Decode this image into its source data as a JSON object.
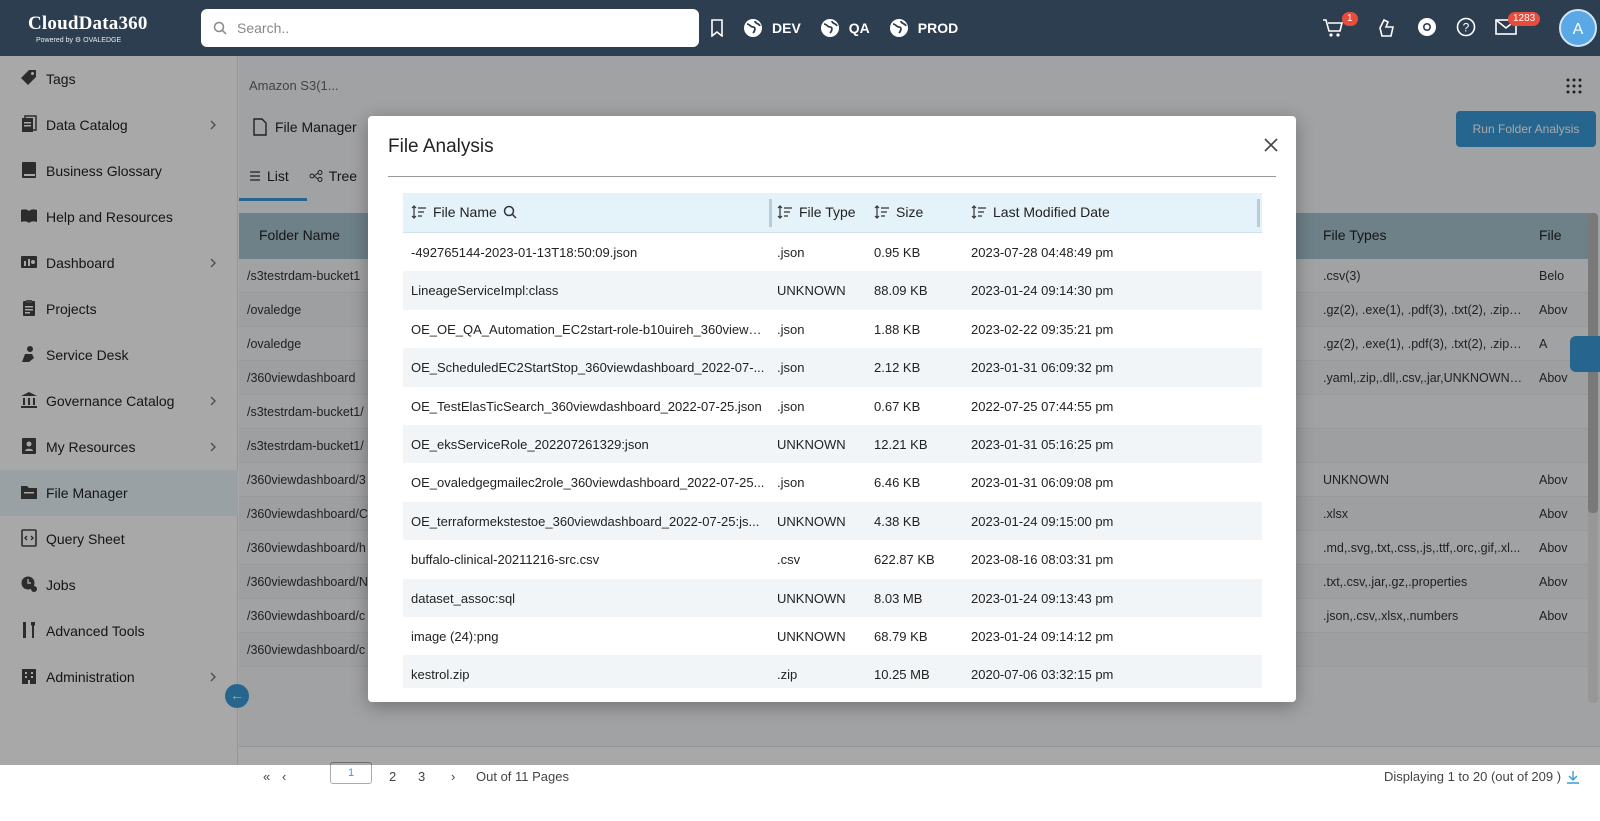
{
  "app": {
    "name": "CloudData360",
    "powered_by": "Powered by ⚙ OVALEDGE"
  },
  "search": {
    "placeholder": "Search.."
  },
  "environments": [
    "DEV",
    "QA",
    "PROD"
  ],
  "topbar": {
    "cart_count": "1",
    "mail_count": "1283",
    "avatar": "A"
  },
  "sidebar": {
    "items": [
      {
        "label": "Tags",
        "icon": "tag-icon",
        "chevron": false
      },
      {
        "label": "Data Catalog",
        "icon": "catalog-icon",
        "chevron": true
      },
      {
        "label": "Business Glossary",
        "icon": "book-icon",
        "chevron": false
      },
      {
        "label": "Help and Resources",
        "icon": "open-book-icon",
        "chevron": false
      },
      {
        "label": "Dashboard",
        "icon": "dashboard-icon",
        "chevron": true
      },
      {
        "label": "Projects",
        "icon": "clipboard-icon",
        "chevron": false
      },
      {
        "label": "Service Desk",
        "icon": "service-desk-icon",
        "chevron": false
      },
      {
        "label": "Governance Catalog",
        "icon": "bank-icon",
        "chevron": true
      },
      {
        "label": "My Resources",
        "icon": "user-card-icon",
        "chevron": true
      },
      {
        "label": "File Manager",
        "icon": "folder-icon",
        "chevron": false,
        "active": true
      },
      {
        "label": "Query Sheet",
        "icon": "code-file-icon",
        "chevron": false
      },
      {
        "label": "Jobs",
        "icon": "clock-icon",
        "chevron": false
      },
      {
        "label": "Advanced Tools",
        "icon": "tools-icon",
        "chevron": false
      },
      {
        "label": "Administration",
        "icon": "building-icon",
        "chevron": true
      }
    ]
  },
  "page": {
    "breadcrumb": "Amazon S3(1...",
    "title": "File Manager",
    "run_button": "Run Folder Analysis",
    "tabs": [
      "List",
      "Tree"
    ]
  },
  "bg_table": {
    "headers": [
      "Folder Name",
      "File Types",
      "File"
    ],
    "rows": [
      [
        "/s3testrdam-bucket1",
        ".csv(3)",
        "Belo"
      ],
      [
        "/ovaledge",
        ".gz(2), .exe(1), .pdf(3), .txt(2), .zip(...",
        "Abov"
      ],
      [
        "/ovaledge",
        ".gz(2), .exe(1), .pdf(3), .txt(2), .zip(...",
        "A"
      ],
      [
        "/360viewdashboard",
        ".yaml,.zip,.dll,.csv,.jar,UNKNOWN,...",
        "Abov"
      ],
      [
        "/s3testrdam-bucket1/",
        "",
        ""
      ],
      [
        "/s3testrdam-bucket1/",
        "",
        ""
      ],
      [
        "/360viewdashboard/3",
        "UNKNOWN",
        "Abov"
      ],
      [
        "/360viewdashboard/C",
        ".xlsx",
        "Abov"
      ],
      [
        "/360viewdashboard/h",
        ".md,.svg,.txt,.css,.js,.ttf,.orc,.gif,.xl...",
        "Abov"
      ],
      [
        "/360viewdashboard/N",
        ".txt,.csv,.jar,.gz,.properties",
        "Abov"
      ],
      [
        "/360viewdashboard/c",
        ".json,.csv,.xlsx,.numbers",
        "Abov"
      ],
      [
        "/360viewdashboard/c",
        "",
        ""
      ]
    ]
  },
  "pager": {
    "current": "1",
    "pages": [
      "2",
      "3"
    ],
    "out_of": "Out of 11 Pages",
    "displaying": "Displaying 1 to 20 (out of 209 )"
  },
  "modal": {
    "title": "File Analysis",
    "headers": [
      "File Name",
      "File Type",
      "Size",
      "Last Modified Date"
    ],
    "rows": [
      [
        "-492765144-2023-01-13T18:50:09.json",
        ".json",
        "0.95 KB",
        "2023-07-28 04:48:49 pm"
      ],
      [
        "LineageServiceImpl:class",
        "UNKNOWN",
        "88.09 KB",
        "2023-01-24 09:14:30 pm"
      ],
      [
        "OE_OE_QA_Automation_EC2start-role-b10uireh_360viewd...",
        ".json",
        "1.88 KB",
        "2023-02-22 09:35:21 pm"
      ],
      [
        "OE_ScheduledEC2StartStop_360viewdashboard_2022-07-...",
        ".json",
        "2.12 KB",
        "2023-01-31 06:09:32 pm"
      ],
      [
        "OE_TestElasTicSearch_360viewdashboard_2022-07-25.json",
        ".json",
        "0.67 KB",
        "2022-07-25 07:44:55 pm"
      ],
      [
        "OE_eksServiceRole_202207261329:json",
        "UNKNOWN",
        "12.21 KB",
        "2023-01-31 05:16:25 pm"
      ],
      [
        "OE_ovaledgegmailec2role_360viewdashboard_2022-07-25...",
        ".json",
        "6.46 KB",
        "2023-01-31 06:09:08 pm"
      ],
      [
        "OE_terraformekstestoe_360viewdashboard_2022-07-25:js...",
        "UNKNOWN",
        "4.38 KB",
        "2023-01-24 09:15:00 pm"
      ],
      [
        "buffalo-clinical-20211216-src.csv",
        ".csv",
        "622.87 KB",
        "2023-08-16 08:03:31 pm"
      ],
      [
        "dataset_assoc:sql",
        "UNKNOWN",
        "8.03 MB",
        "2023-01-24 09:13:43 pm"
      ],
      [
        "image (24):png",
        "UNKNOWN",
        "68.79 KB",
        "2023-01-24 09:14:12 pm"
      ],
      [
        "kestrol.zip",
        ".zip",
        "10.25 MB",
        "2020-07-06 03:32:15 pm"
      ]
    ]
  },
  "colors": {
    "topbar": "#2c3e50",
    "accent": "#3a9bd8",
    "badge": "#e74c3c",
    "active_nav": "#e8f4fb",
    "table_header": "#e4f2fa"
  }
}
